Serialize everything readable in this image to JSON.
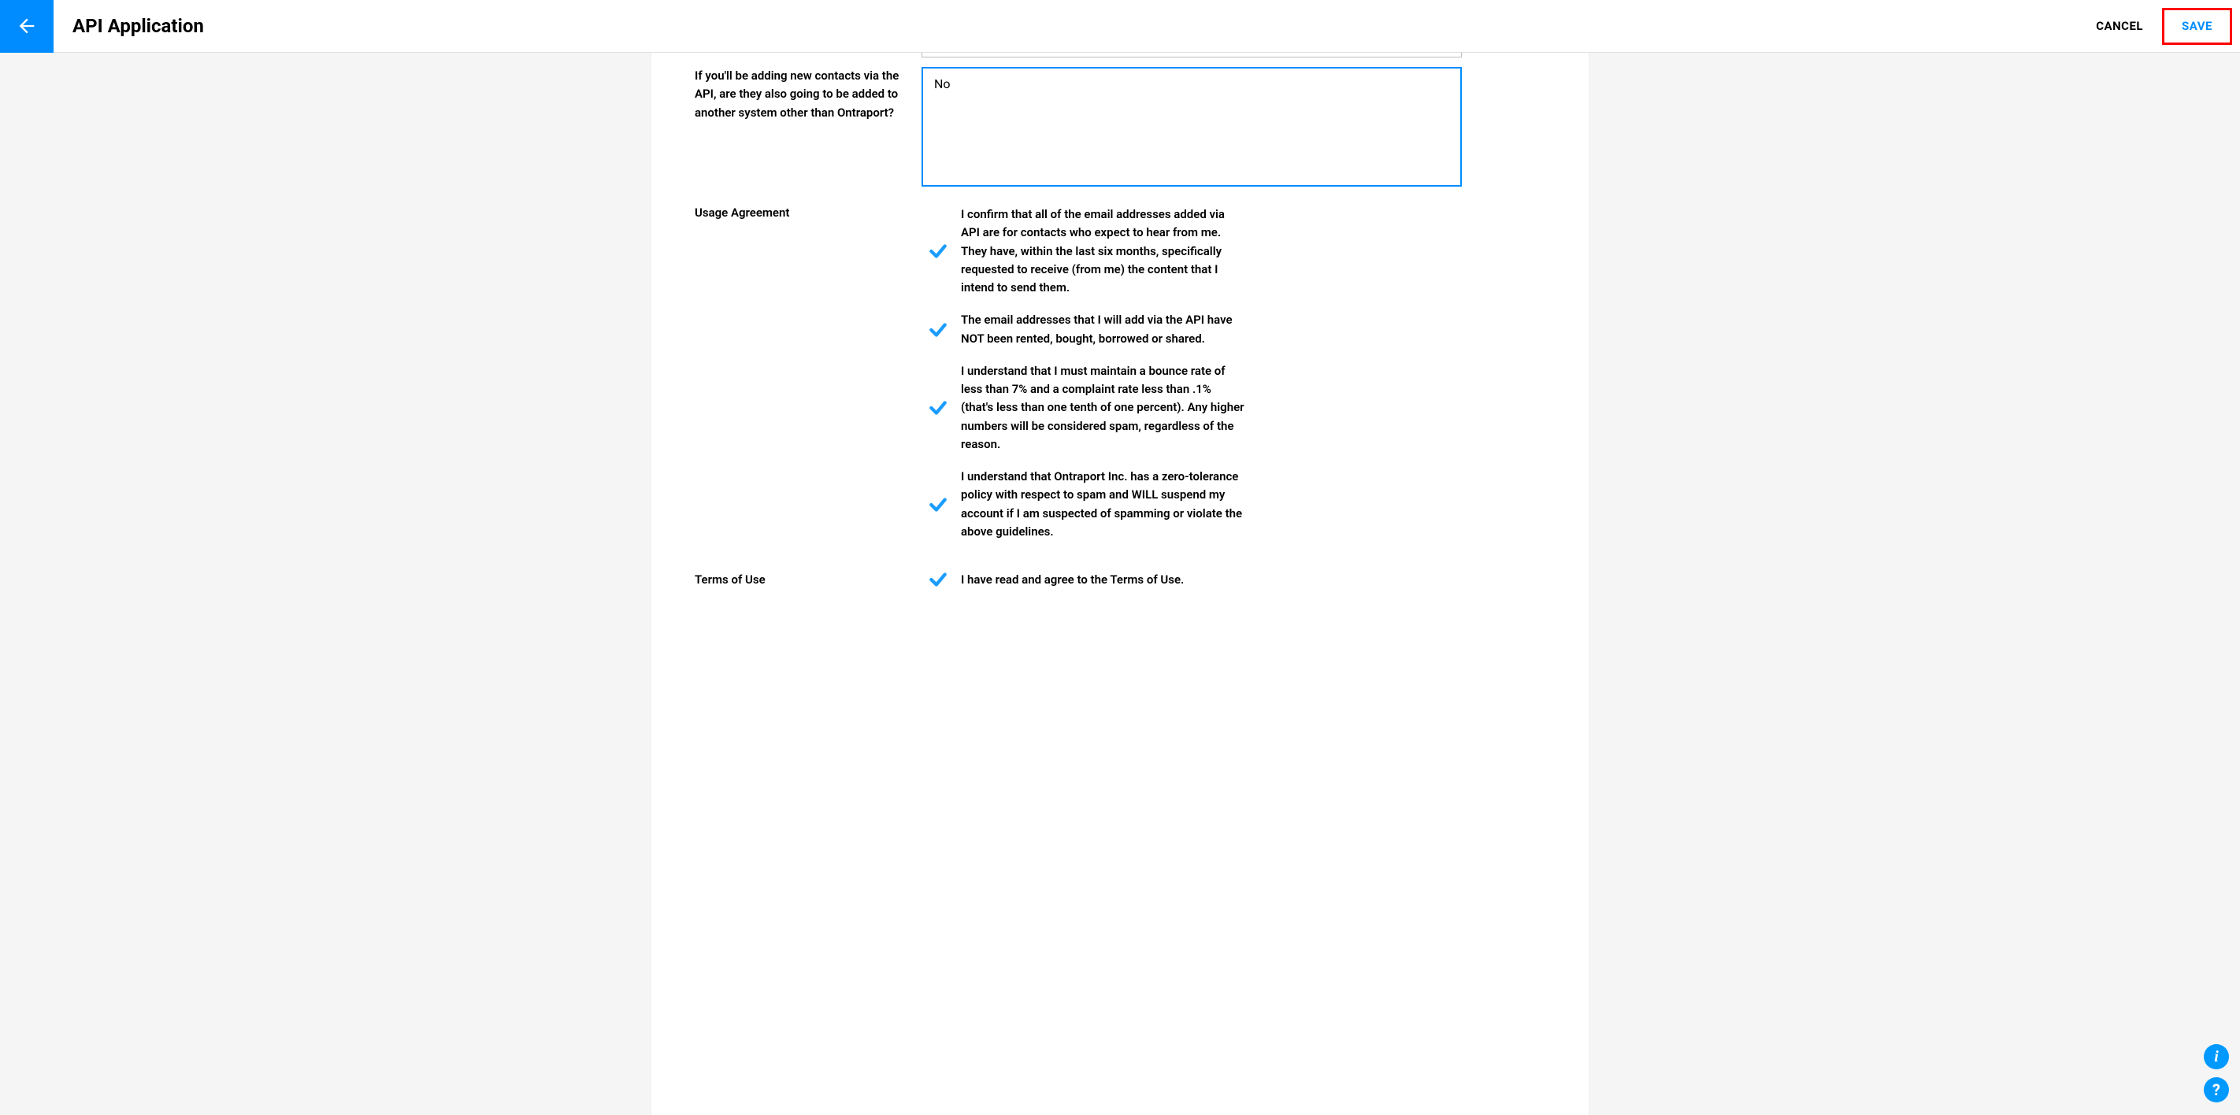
{
  "header": {
    "title": "API Application",
    "cancel_label": "CANCEL",
    "save_label": "SAVE"
  },
  "form": {
    "question_label": "If you'll be adding new contacts via the API, are they also going to be added to another system other than Ontraport?",
    "question_value": "No",
    "usage_agreement_label": "Usage Agreement",
    "agreements": [
      "I confirm that all of the email addresses added via API are for contacts who expect to hear from me. They have, within the last six months, specifically requested to receive (from me) the content that I intend to send them.",
      "The email addresses that I will add via the API have NOT been rented, bought, borrowed or shared.",
      "I understand that I must maintain a bounce rate of less than 7% and a complaint rate less than .1% (that's less than one tenth of one percent). Any higher numbers will be considered spam, regardless of the reason.",
      "I understand that Ontraport Inc. has a zero-tolerance policy with respect to spam and WILL suspend my account if I am suspected of spamming or violate the above guidelines."
    ],
    "terms_label": "Terms of Use",
    "terms_text": "I have read and agree to the Terms of Use."
  },
  "colors": {
    "accent": "#008cff",
    "highlight": "#ff0000"
  }
}
